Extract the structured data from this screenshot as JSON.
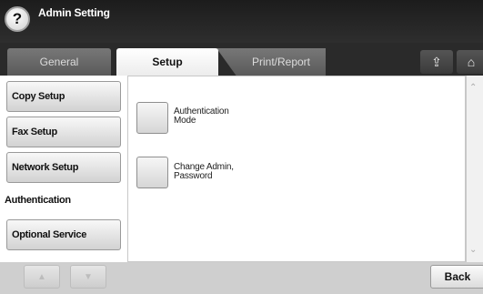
{
  "window": {
    "title": "Admin Setting",
    "help_glyph": "?"
  },
  "tabs": [
    {
      "label": "General"
    },
    {
      "label": "Setup"
    },
    {
      "label": "Print/Report"
    }
  ],
  "tab_icons": {
    "export_glyph": "⇪",
    "home_glyph": "⌂"
  },
  "sidebar": {
    "items": [
      {
        "label": "Copy Setup"
      },
      {
        "label": "Fax Setup"
      },
      {
        "label": "Network Setup"
      },
      {
        "label": "Authentication"
      },
      {
        "label": "Optional Service"
      }
    ],
    "active_index": 3,
    "scroll_up_glyph": "▲",
    "scroll_down_glyph": "▼"
  },
  "options": [
    {
      "line1": "Authentication",
      "line2": "Mode"
    },
    {
      "line1": "Change Admin,",
      "line2": "Password"
    }
  ],
  "scrollbar": {
    "up_glyph": "⌃",
    "down_glyph": "⌄"
  },
  "footer": {
    "back_label": "Back"
  }
}
